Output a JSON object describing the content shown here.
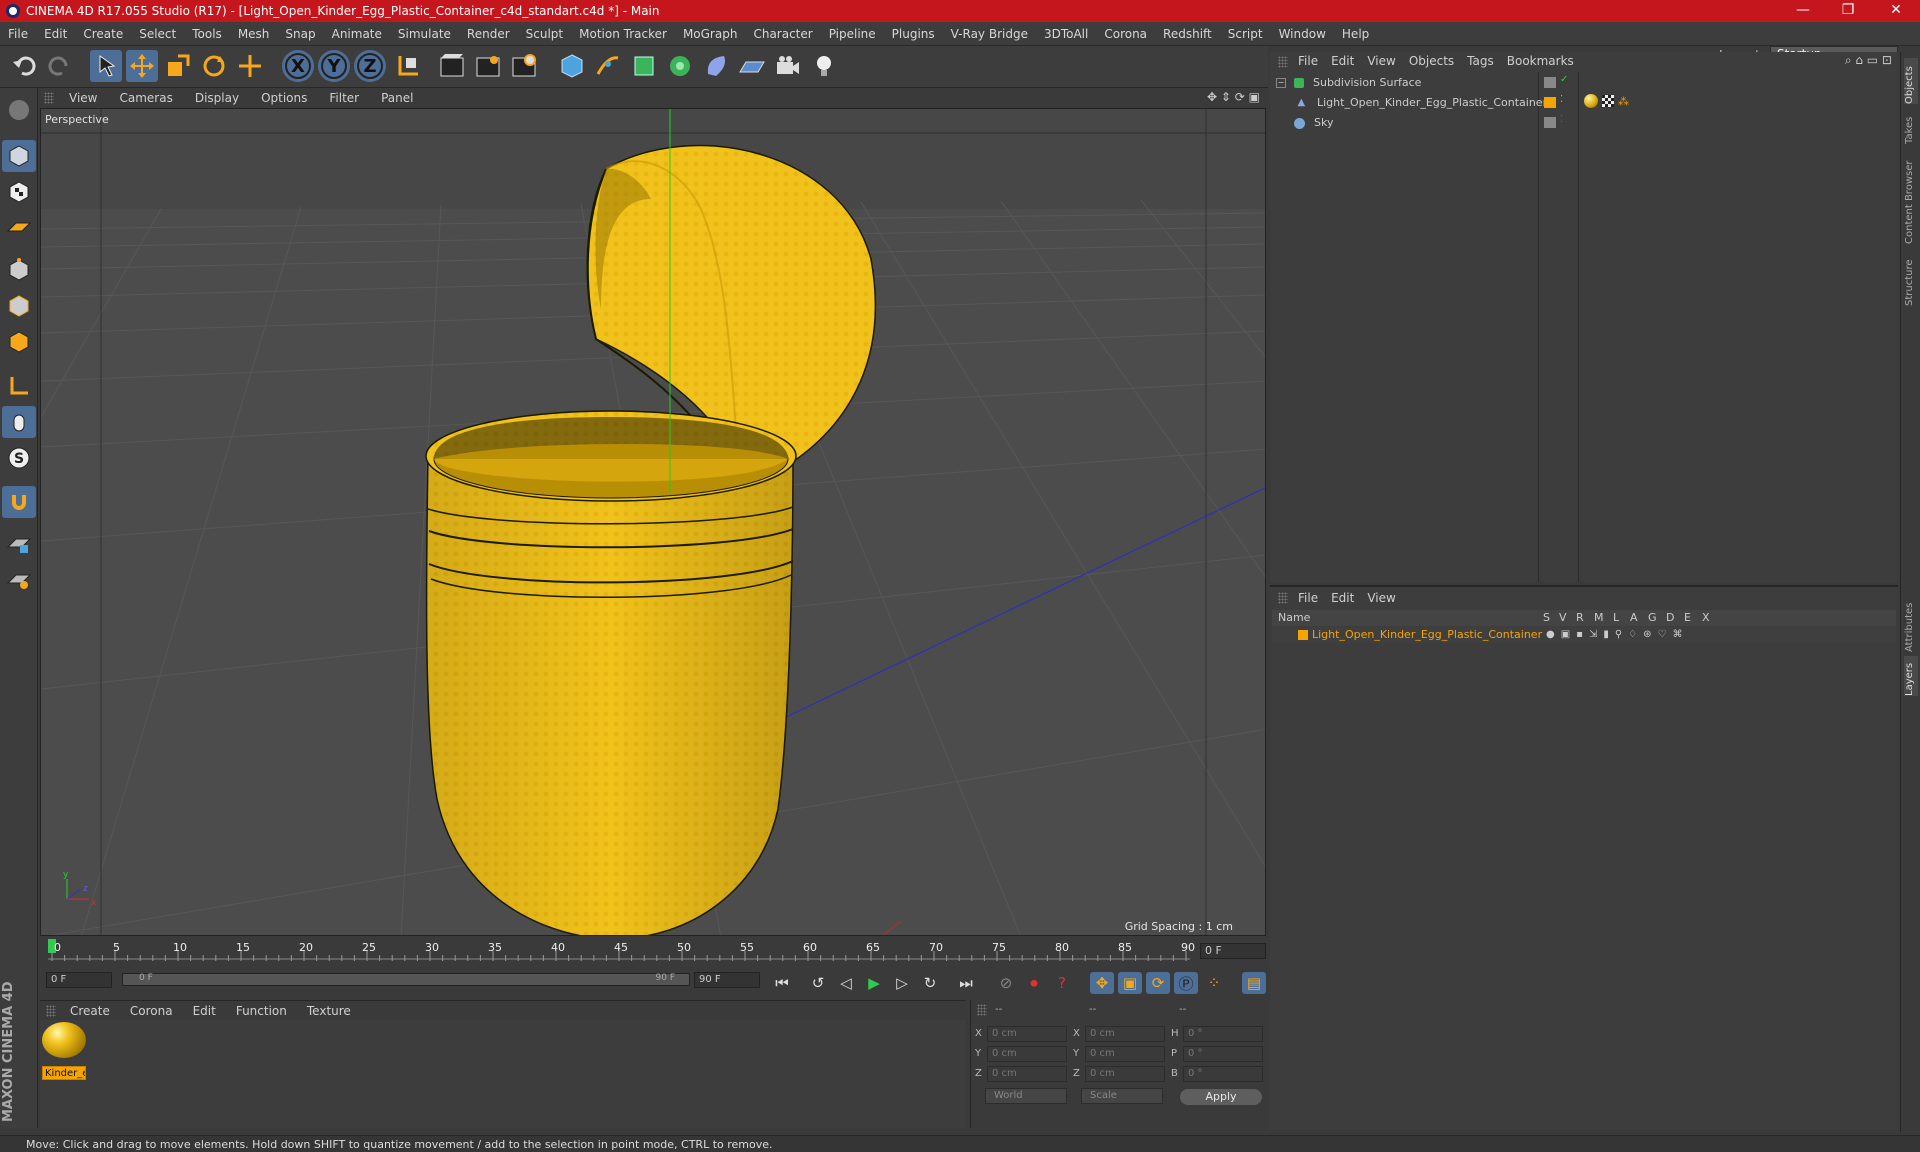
{
  "window": {
    "title": "CINEMA 4D R17.055 Studio (R17) - [Light_Open_Kinder_Egg_Plastic_Container_c4d_standart.c4d *] - Main",
    "minimize": "—",
    "maximize": "❐",
    "close": "✕"
  },
  "menubar": {
    "items": [
      "File",
      "Edit",
      "Create",
      "Select",
      "Tools",
      "Mesh",
      "Snap",
      "Animate",
      "Simulate",
      "Render",
      "Sculpt",
      "Motion Tracker",
      "MoGraph",
      "Character",
      "Pipeline",
      "Plugins",
      "V-Ray Bridge",
      "3DToAll",
      "Corona",
      "Redshift",
      "Script",
      "Window",
      "Help"
    ],
    "layout_label": "Layout:",
    "layout_value": "Startup"
  },
  "toolbar": {
    "axis_x": "X",
    "axis_y": "Y",
    "axis_z": "Z"
  },
  "viewport": {
    "menu": [
      "View",
      "Cameras",
      "Display",
      "Options",
      "Filter",
      "Panel"
    ],
    "label": "Perspective",
    "grid_spacing": "Grid Spacing : 1 cm"
  },
  "timeline": {
    "ticks": [
      "0",
      "5",
      "10",
      "15",
      "20",
      "25",
      "30",
      "35",
      "40",
      "45",
      "50",
      "55",
      "60",
      "65",
      "70",
      "75",
      "80",
      "85",
      "90"
    ],
    "current_frame": "0 F",
    "start_field": "0 F",
    "range_start": "0 F",
    "range_end": "90 F",
    "end_field": "90 F"
  },
  "material_manager": {
    "menu": [
      "Create",
      "Corona",
      "Edit",
      "Function",
      "Texture"
    ],
    "material_name": "Kinder_e"
  },
  "coordinates": {
    "header": [
      "--",
      "--",
      "--"
    ],
    "rows": [
      {
        "a": "X",
        "av": "0 cm",
        "b": "X",
        "bv": "0 cm",
        "c": "H",
        "cv": "0 °"
      },
      {
        "a": "Y",
        "av": "0 cm",
        "b": "Y",
        "bv": "0 cm",
        "c": "P",
        "cv": "0 °"
      },
      {
        "a": "Z",
        "av": "0 cm",
        "b": "Z",
        "bv": "0 cm",
        "c": "B",
        "cv": "0 °"
      }
    ],
    "mode": "World",
    "type": "Scale",
    "apply": "Apply"
  },
  "object_manager": {
    "menu": [
      "File",
      "Edit",
      "View",
      "Objects",
      "Tags",
      "Bookmarks"
    ],
    "objects": [
      "Subdivision Surface",
      "Light_Open_Kinder_Egg_Plastic_Container",
      "Sky"
    ]
  },
  "layer_manager": {
    "menu": [
      "File",
      "Edit",
      "View"
    ],
    "columns": "Name",
    "flags": [
      "S",
      "V",
      "R",
      "M",
      "L",
      "A",
      "G",
      "D",
      "E",
      "X"
    ],
    "layer": "Light_Open_Kinder_Egg_Plastic_Container"
  },
  "right_tabs": [
    "Objects",
    "Takes",
    "Content Browser",
    "Structure",
    "Attributes",
    "Layers"
  ],
  "status": "Move: Click and drag to move elements. Hold down SHIFT to quantize movement / add to the selection in point mode, CTRL to remove.",
  "colors": {
    "titlebar": "#c4161c",
    "accent_blue": "#4d6e96",
    "egg_yellow": "#f1c21b",
    "selection_orange": "#f5a400"
  },
  "brand": "MAXON CINEMA 4D"
}
